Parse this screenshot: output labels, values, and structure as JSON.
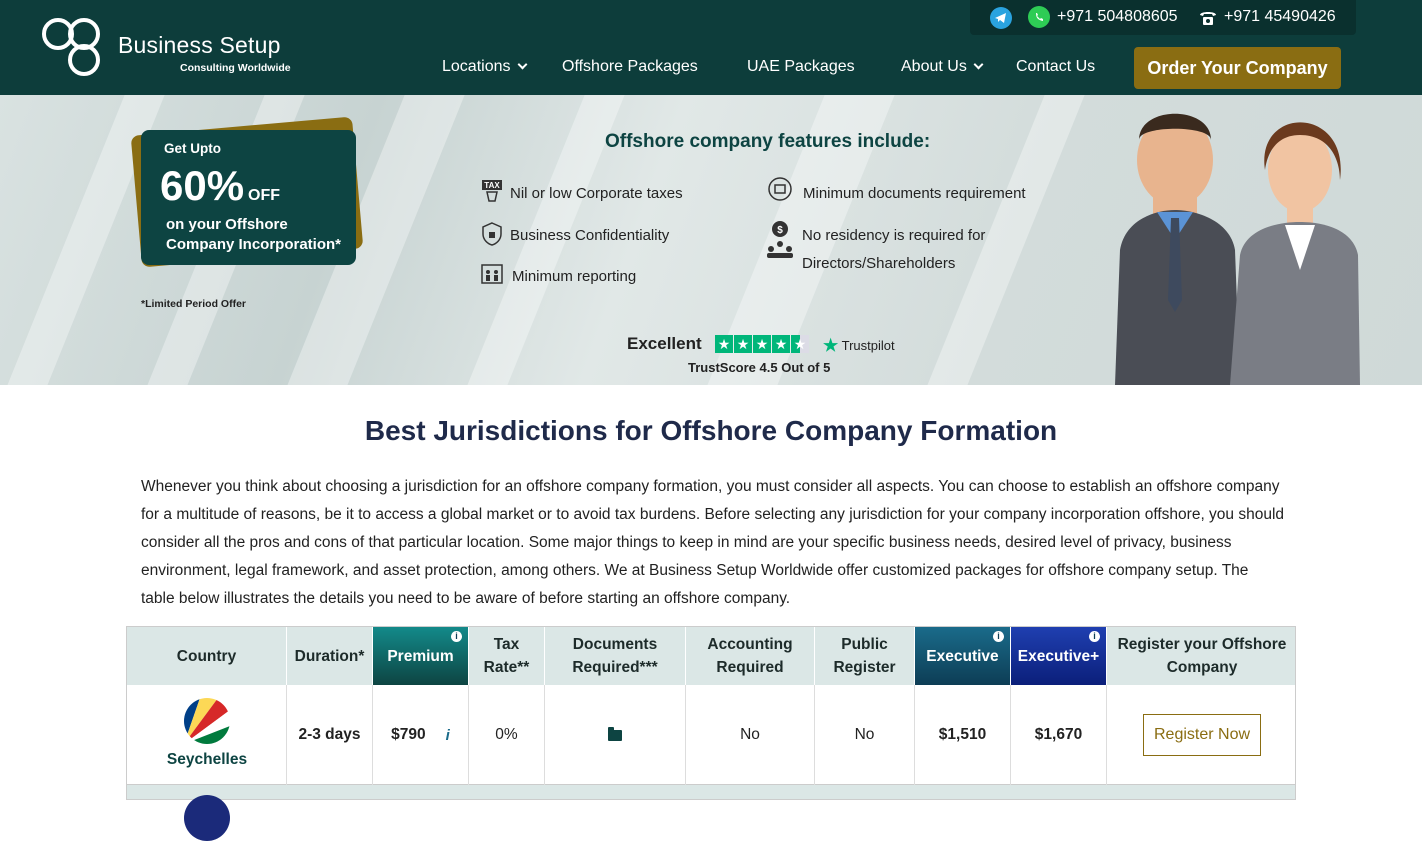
{
  "header": {
    "logo_name": "Business Setup",
    "logo_tagline": "Consulting Worldwide",
    "phone_whatsapp": "+971 504808605",
    "phone_landline": "+971 45490426",
    "nav": [
      {
        "label": "Locations",
        "dropdown": true
      },
      {
        "label": "Offshore Packages",
        "dropdown": false
      },
      {
        "label": "UAE Packages",
        "dropdown": false
      },
      {
        "label": "About Us",
        "dropdown": true
      },
      {
        "label": "Contact Us",
        "dropdown": false
      }
    ],
    "cta": "Order Your Company"
  },
  "promo": {
    "line1": "Get Upto",
    "percent": "60%",
    "off": "OFF",
    "line3": "on your Offshore",
    "line4": "Company Incorporation*",
    "note": "*Limited Period Offer"
  },
  "features": {
    "title": "Offshore company features include:",
    "items": [
      "Nil or low Corporate taxes",
      "Minimum documents requirement",
      "Business Confidentiality",
      "No residency is required for",
      "Directors/Shareholders",
      "Minimum reporting"
    ]
  },
  "trust": {
    "rating_word": "Excellent",
    "brand": "Trustpilot",
    "score_text": "TrustScore 4.5 Out of 5",
    "stars": 4.5
  },
  "main": {
    "heading": "Best Jurisdictions for Offshore Company Formation",
    "intro": "Whenever you think about choosing a jurisdiction for an offshore company formation, you must consider all aspects. You can choose to establish an offshore company for a multitude of reasons, be it to access a global market or to avoid tax burdens. Before selecting any jurisdiction for your company incorporation offshore, you should consider all the pros and cons of that particular location. Some major things to keep in mind are your specific business needs, desired level of privacy, business environment, legal framework, and asset protection, among others. We at Business Setup Worldwide offer customized packages for offshore company setup. The table below illustrates the details you need to be aware of before starting an offshore company."
  },
  "table": {
    "headers": [
      "Country",
      "Duration*",
      "Premium",
      "Tax Rate**",
      "Documents Required***",
      "Accounting Required",
      "Public Register",
      "Executive",
      "Executive+",
      "Register your Offshore Company"
    ],
    "rows": [
      {
        "country": "Seychelles",
        "duration": "2-3 days",
        "premium": "$790",
        "tax_rate": "0%",
        "accounting": "No",
        "public_register": "No",
        "executive": "$1,510",
        "executive_plus": "$1,670",
        "action": "Register Now"
      }
    ]
  },
  "colors": {
    "brand_dark": "#0d3d3b",
    "gold": "#8a6d12",
    "trustpilot_green": "#00b67a"
  }
}
